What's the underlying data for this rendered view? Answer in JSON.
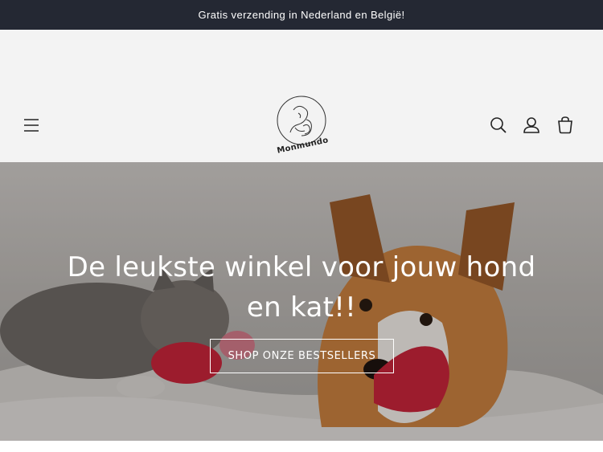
{
  "announcement": {
    "text": "Gratis verzending in Nederland en België!"
  },
  "header": {
    "logo_text": "Monmundo",
    "icons": [
      "menu-icon",
      "search-icon",
      "account-icon",
      "cart-icon"
    ]
  },
  "hero": {
    "title": "De leukste winkel voor jouw hond en kat!!",
    "button_label": "SHOP ONZE BESTSELLERS"
  },
  "colors": {
    "announcement_bg": "#242833",
    "header_bg": "#f3f3f3",
    "accent_red": "#c8243a"
  }
}
